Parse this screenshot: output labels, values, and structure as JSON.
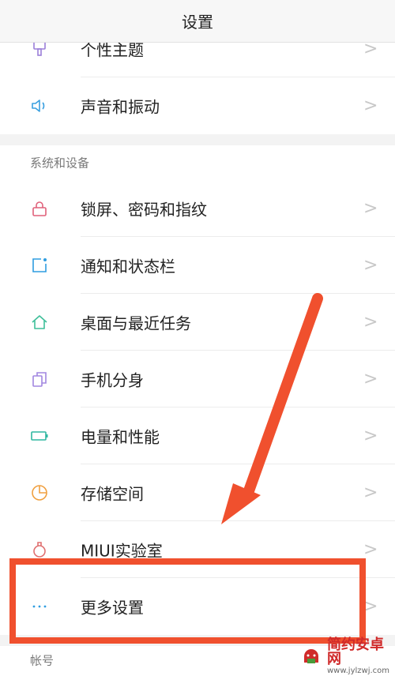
{
  "header": {
    "title": "设置"
  },
  "rows_top": [
    {
      "label": "个性主题",
      "icon": "theme-brush-icon",
      "color": "#9b7fd9"
    },
    {
      "label": "声音和振动",
      "icon": "speaker-icon",
      "color": "#3aa0e0"
    }
  ],
  "section_system": "系统和设备",
  "rows_system": [
    {
      "label": "锁屏、密码和指纹",
      "icon": "lock-icon",
      "color": "#e0607a"
    },
    {
      "label": "通知和状态栏",
      "icon": "notification-icon",
      "color": "#2f9de0"
    },
    {
      "label": "桌面与最近任务",
      "icon": "home-icon",
      "color": "#3fbf9a"
    },
    {
      "label": "手机分身",
      "icon": "dual-apps-icon",
      "color": "#a287e0"
    },
    {
      "label": "电量和性能",
      "icon": "battery-icon",
      "color": "#2fb7a0"
    },
    {
      "label": "存储空间",
      "icon": "storage-pie-icon",
      "color": "#f0a040"
    },
    {
      "label": "MIUI实验室",
      "icon": "lab-flask-icon",
      "color": "#e07070"
    },
    {
      "label": "更多设置",
      "icon": "more-dots-icon",
      "color": "#2f9de0"
    }
  ],
  "section_account": "帐号",
  "chevron": ">",
  "annotation": {
    "color": "#f0502e"
  },
  "watermark": {
    "title": "简约安卓网",
    "url": "www.jylzwj.com"
  }
}
